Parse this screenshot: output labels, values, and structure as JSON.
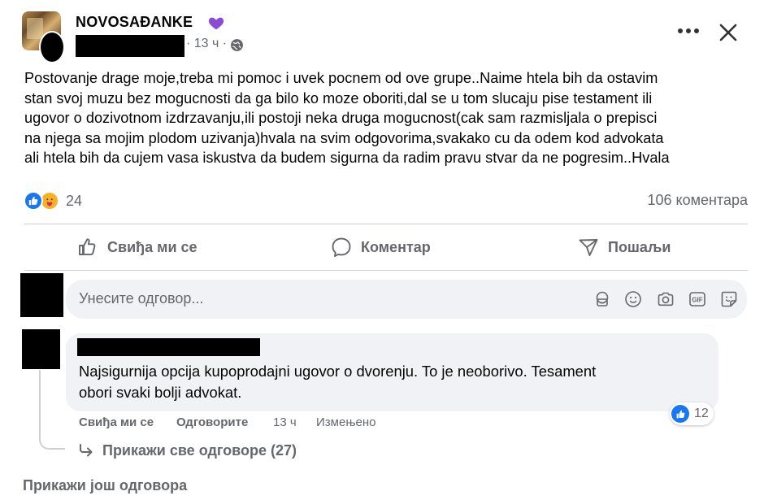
{
  "post": {
    "group_name": "NOVOSAĐANKE",
    "time": "· 13 ч ·",
    "text": "Postovanje drage moje,treba mi pomoc i uvek pocnem od ove grupe..Naime htela bih da ostavim\nstan svoj muzu bez mogucnosti da ga bilo ko moze oboriti,dal se u tom slucaju pise testament ili\nugovor o dozivotnom izdrzavanju,ili postoji neka druga mogucnost(cak sam razmisljala o prepisci\nna njega sa mojim plodom uzivanja)hvala na svim odgovorima,svakako cu da odem kod advokata\nali htela bih da cujem vasa iskustva da budem sigurna da radim pravu stvar da ne pogresim..Hvala",
    "reaction_count": "24",
    "comment_count": "106 коментара"
  },
  "actions": {
    "like": "Свиђа ми се",
    "comment": "Коментар",
    "share": "Пошаљи"
  },
  "composer": {
    "placeholder": "Унесите одговор..."
  },
  "comment": {
    "text": "Najsigurnija opcija kupoprodajni ugovor o dvorenju. To je neoborivo. Tesament\nobori svaki bolji advokat.",
    "like_label": "Свиђа ми се",
    "reply_label": "Одговорите",
    "time": "13 ч",
    "edited": "Измењено",
    "reaction_count": "12",
    "view_replies": "Прикажи све одговоре (27)"
  },
  "more_comments": "Прикажи још одговора",
  "colors": {
    "accent": "#1877f2",
    "secondary_text": "#65676b",
    "bubble_bg": "#f0f2f5",
    "heart": "#8a4bd6"
  }
}
